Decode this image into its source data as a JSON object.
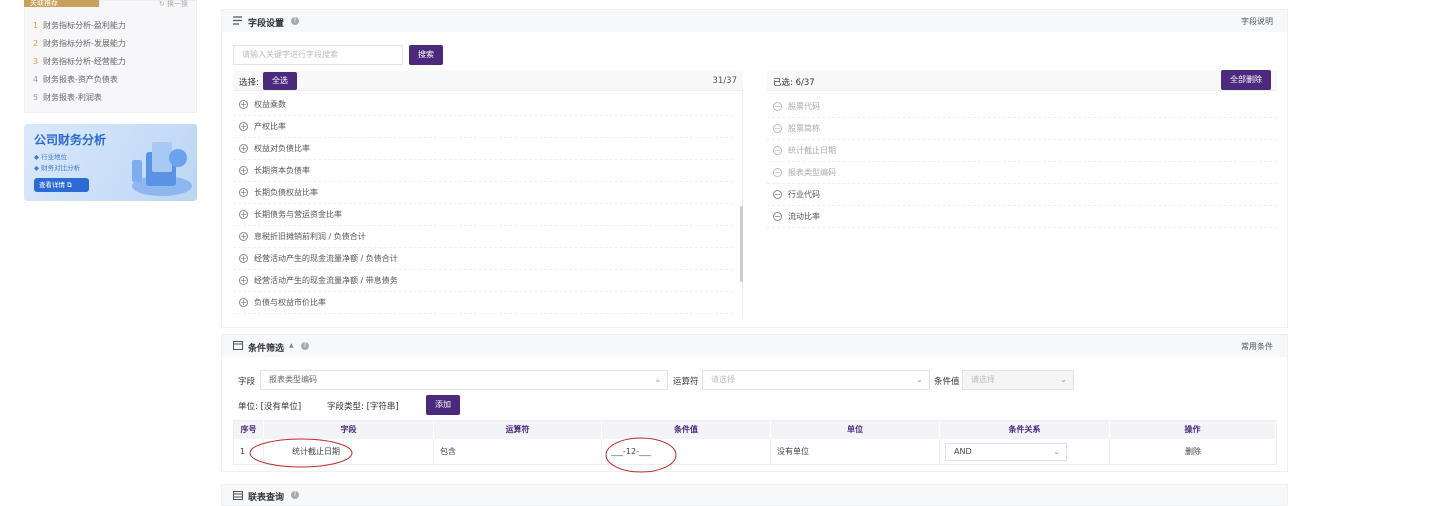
{
  "left": {
    "title": "关联推荐",
    "switch_label": "↻ 换一换",
    "items": [
      {
        "n": "1",
        "label": "财务指标分析-盈利能力"
      },
      {
        "n": "2",
        "label": "财务指标分析-发展能力"
      },
      {
        "n": "3",
        "label": "财务指标分析-经营能力"
      },
      {
        "n": "4",
        "label": "财务报表-资产负债表"
      },
      {
        "n": "5",
        "label": "财务报表-利润表"
      }
    ],
    "banner": {
      "title": "公司财务分析",
      "b1": "◆ 行业地位",
      "b2": "◆ 财务对比分析",
      "btn": "查看详情 ⧉"
    }
  },
  "field": {
    "title": "字段设置",
    "help": "?",
    "doc_link": "字段说明",
    "search_placeholder": "请输入关键字进行字段搜索",
    "search_btn": "搜索",
    "select_label": "选择:",
    "select_all": "全选",
    "count": "31/37",
    "available": [
      "权益乘数",
      "产权比率",
      "权益对负债比率",
      "长期资本负债率",
      "长期负债权益比率",
      "长期债务与营运资金比率",
      "息税折旧摊销前利润 / 负债合计",
      "经营活动产生的现金流量净额 / 负债合计",
      "经营活动产生的现金流量净额 / 带息债务",
      "负债与权益市价比率"
    ],
    "selected_label": "已选: 6/37",
    "delete_all": "全部删除",
    "selected": [
      {
        "label": "股票代码",
        "dim": true
      },
      {
        "label": "股票简称",
        "dim": true
      },
      {
        "label": "统计截止日期",
        "dim": true
      },
      {
        "label": "报表类型编码",
        "dim": true
      },
      {
        "label": "行业代码",
        "dim": false
      },
      {
        "label": "流动比率",
        "dim": false
      }
    ]
  },
  "cond": {
    "title": "条件筛选",
    "arrow": "▲",
    "help": "?",
    "common": "常用条件",
    "field_label": "字段",
    "field_value": "报表类型编码",
    "op_label": "运算符",
    "op_placeholder": "请选择",
    "val_label": "条件值",
    "val_placeholder": "请选择",
    "unit_info": "单位: [没有单位]",
    "type_info": "字段类型: [字符串]",
    "add_btn": "添加",
    "columns": [
      "序号",
      "字段",
      "运算符",
      "条件值",
      "单位",
      "条件关系",
      "操作"
    ],
    "row": {
      "no": "1",
      "field": "统计截止日期",
      "op": "包含",
      "value": "___-12-___",
      "unit": "没有单位",
      "relation": "AND",
      "action": "删除"
    }
  },
  "union": {
    "title": "联表查询",
    "help": "?"
  },
  "colors": {
    "primary": "#4b2a7d",
    "annotation": "#c0272d"
  }
}
